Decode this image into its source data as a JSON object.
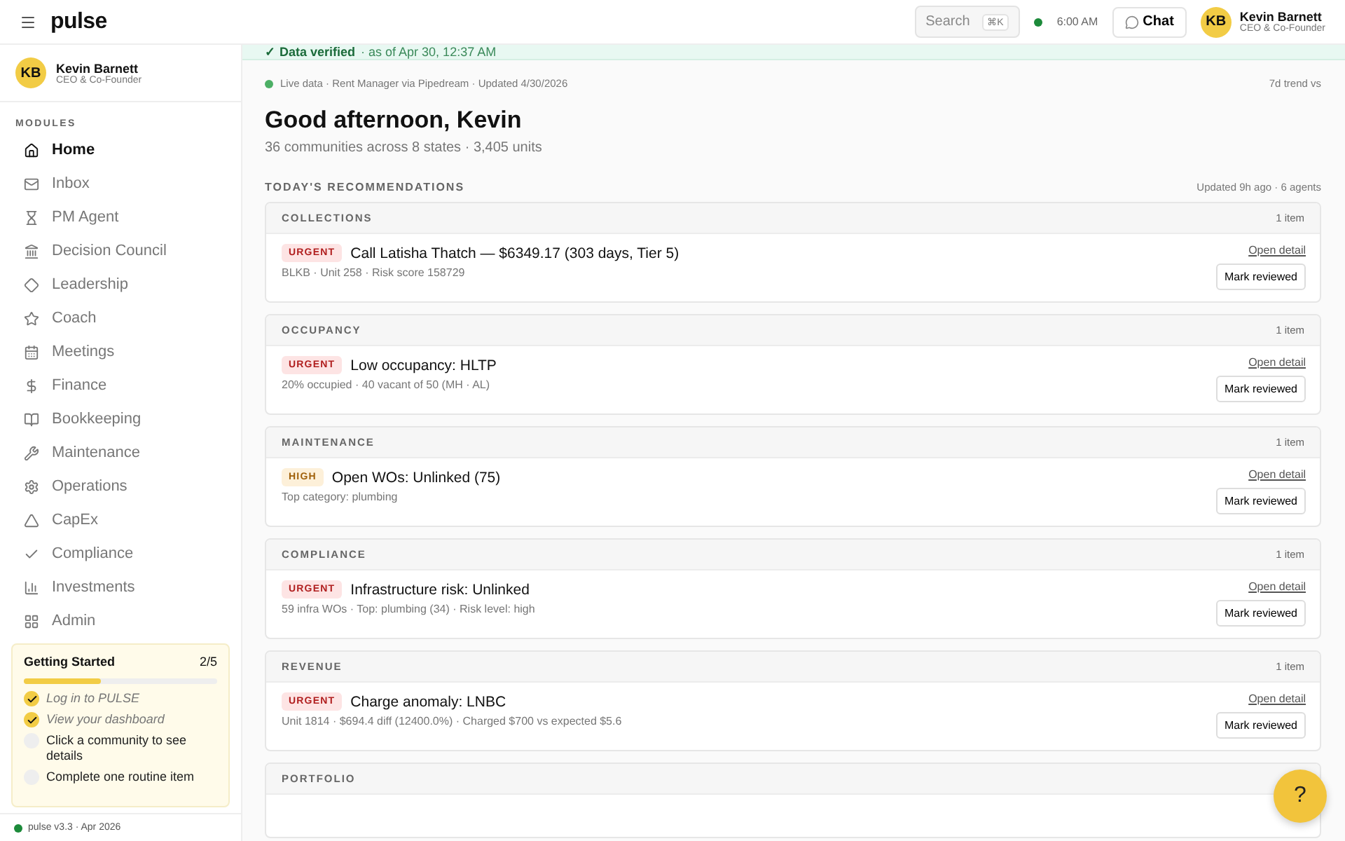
{
  "topbar": {
    "brand": "pulse",
    "search": {
      "placeholder": "Search",
      "shortcut": "⌘K"
    },
    "time": "6:00 AM",
    "chat": "Chat",
    "user": {
      "initials": "KB",
      "name": "Kevin Barnett",
      "role": "CEO & Co-Founder"
    }
  },
  "sidebar": {
    "user": {
      "initials": "KB",
      "name": "Kevin Barnett",
      "role": "CEO & Co-Founder"
    },
    "heading": "MODULES",
    "items": [
      {
        "label": "Home",
        "selected": true
      },
      {
        "label": "Inbox",
        "selected": false
      },
      {
        "label": "PM Agent",
        "selected": false
      },
      {
        "label": "Decision Council",
        "selected": false
      },
      {
        "label": "Leadership",
        "selected": false
      },
      {
        "label": "Coach",
        "selected": false
      },
      {
        "label": "Meetings",
        "selected": false
      },
      {
        "label": "Finance",
        "selected": false
      },
      {
        "label": "Bookkeeping",
        "selected": false
      },
      {
        "label": "Maintenance",
        "selected": false
      },
      {
        "label": "Operations",
        "selected": false
      },
      {
        "label": "CapEx",
        "selected": false
      },
      {
        "label": "Compliance",
        "selected": false
      },
      {
        "label": "Investments",
        "selected": false
      },
      {
        "label": "Admin",
        "selected": false
      }
    ],
    "getting_started": {
      "title": "Getting Started",
      "count": "2/5",
      "level": 0.4,
      "steps": [
        {
          "label": "Log in to PULSE",
          "checked": true
        },
        {
          "label": "View your dashboard",
          "checked": true
        },
        {
          "label": "Click a community to see details",
          "checked": false
        },
        {
          "label": "Complete one routine item",
          "checked": false
        }
      ]
    },
    "footer": "pulse v3.3 · Apr 2026"
  },
  "banner": {
    "label": "✓ Data verified",
    "detail": "· as of Apr 30, 12:37 AM"
  },
  "main": {
    "source": "Live data · Rent Manager via Pipedream · Updated 4/30/2026",
    "trend": "7d trend vs",
    "greeting": "Good afternoon, Kevin",
    "summary": "36 communities across 8 states · 3,405 units",
    "recommendations": {
      "title": "TODAY'S RECOMMENDATIONS",
      "updated": "Updated 9h ago · 6 agents",
      "sections": [
        {
          "title": "COLLECTIONS",
          "count": "1 item",
          "items": [
            {
              "priority": "URGENT",
              "kind": "urgent",
              "title": "Call Latisha Thatch — $6349.17 (303 days, Tier 5)",
              "meta": "BLKB · Unit 258 · Risk score 158729",
              "link": "Open detail",
              "action": "Mark reviewed"
            }
          ]
        },
        {
          "title": "OCCUPANCY",
          "count": "1 item",
          "items": [
            {
              "priority": "URGENT",
              "kind": "urgent",
              "title": "Low occupancy: HLTP",
              "meta": "20% occupied · 40 vacant of 50 (MH · AL)",
              "link": "Open detail",
              "action": "Mark reviewed"
            }
          ]
        },
        {
          "title": "MAINTENANCE",
          "count": "1 item",
          "items": [
            {
              "priority": "HIGH",
              "kind": "high",
              "title": "Open WOs: Unlinked (75)",
              "meta": "Top category: plumbing",
              "link": "Open detail",
              "action": "Mark reviewed"
            }
          ]
        },
        {
          "title": "COMPLIANCE",
          "count": "1 item",
          "items": [
            {
              "priority": "URGENT",
              "kind": "urgent",
              "title": "Infrastructure risk: Unlinked",
              "meta": "59 infra WOs · Top: plumbing (34) · Risk level: high",
              "link": "Open detail",
              "action": "Mark reviewed"
            }
          ]
        },
        {
          "title": "REVENUE",
          "count": "1 item",
          "items": [
            {
              "priority": "URGENT",
              "kind": "urgent",
              "title": "Charge anomaly: LNBC",
              "meta": "Unit 1814 · $694.4 diff (12400.0%) · Charged $700 vs expected $5.6",
              "link": "Open detail",
              "action": "Mark reviewed"
            }
          ]
        },
        {
          "title": "PORTFOLIO"
        }
      ]
    }
  },
  "help": "?"
}
